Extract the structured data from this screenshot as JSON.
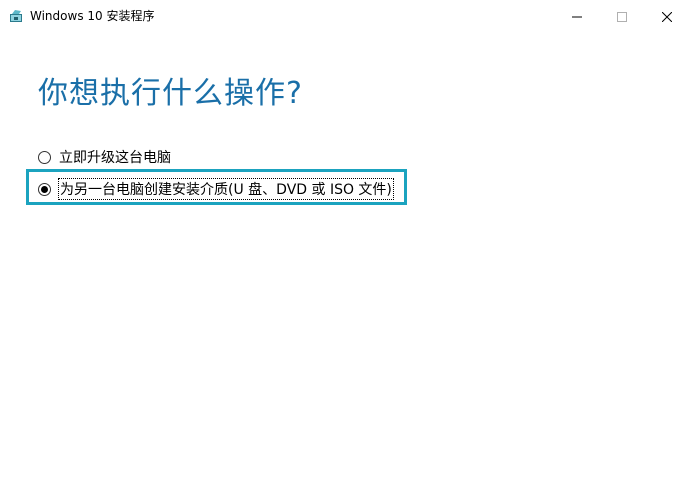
{
  "window": {
    "title": "Windows 10 安装程序",
    "icon": "windows-setup-icon",
    "controls": {
      "minimize_icon": "minimize-icon",
      "maximize_icon": "maximize-icon",
      "close_icon": "close-icon"
    }
  },
  "main": {
    "heading": "你想执行什么操作?",
    "options": [
      {
        "label": "立即升级这台电脑",
        "selected": false
      },
      {
        "label": "为另一台电脑创建安装介质(U 盘、DVD 或 ISO 文件)",
        "selected": true
      }
    ]
  },
  "colors": {
    "heading": "#1a6fa8",
    "highlight_border": "#1ba3bf"
  }
}
